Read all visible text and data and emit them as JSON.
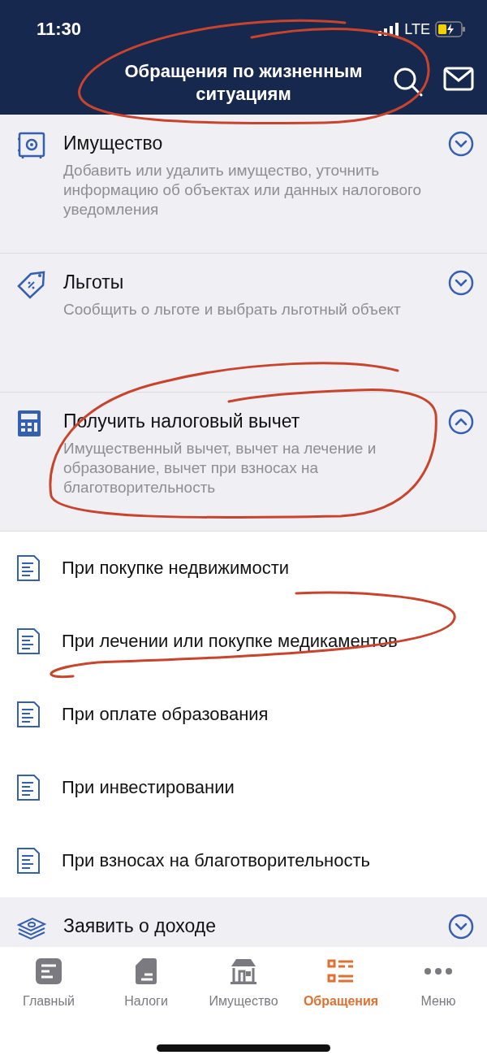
{
  "status_bar": {
    "time": "11:30",
    "network": "LTE"
  },
  "header": {
    "title": "Обращения по жизненным ситуациям"
  },
  "sections": [
    {
      "title": "Имущество",
      "description": "Добавить или удалить имущество, уточнить информацию об объектах или данных налогового уведомления",
      "expanded": false
    },
    {
      "title": "Льготы",
      "description": "Сообщить о льготе и выбрать льготный объект",
      "expanded": false
    },
    {
      "title": "Получить налоговый вычет",
      "description": "Имущественный вычет, вычет на лечение и образование, вычет при взносах на благотворительность",
      "expanded": true,
      "children": [
        {
          "title": "При покупке недвижимости"
        },
        {
          "title": "При лечении или покупке медикаментов"
        },
        {
          "title": "При оплате образования"
        },
        {
          "title": "При инвестировании"
        },
        {
          "title": "При взносах на благотворительность"
        }
      ]
    },
    {
      "title": "Заявить о доходе",
      "expanded": false
    }
  ],
  "tab_bar": [
    {
      "label": "Главный",
      "selected": false
    },
    {
      "label": "Налоги",
      "selected": false
    },
    {
      "label": "Имущество",
      "selected": false
    },
    {
      "label": "Обращения",
      "selected": true
    },
    {
      "label": "Меню",
      "selected": false
    }
  ]
}
